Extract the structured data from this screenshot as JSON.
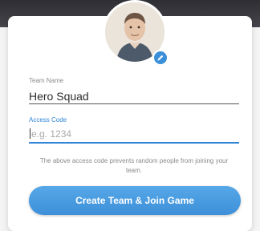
{
  "form": {
    "team_name_label": "Team Name",
    "team_name_value": "Hero Squad",
    "access_code_label": "Access Code",
    "access_code_placeholder": "e.g. 1234",
    "hint_text": "The above access code prevents random people from joining your team."
  },
  "actions": {
    "create_button_label": "Create Team & Join Game"
  },
  "colors": {
    "accent": "#2f86d6",
    "button": "#4a9be0",
    "topbar": "#38383d"
  },
  "icons": {
    "avatar": "user-photo",
    "edit": "pencil-icon"
  }
}
